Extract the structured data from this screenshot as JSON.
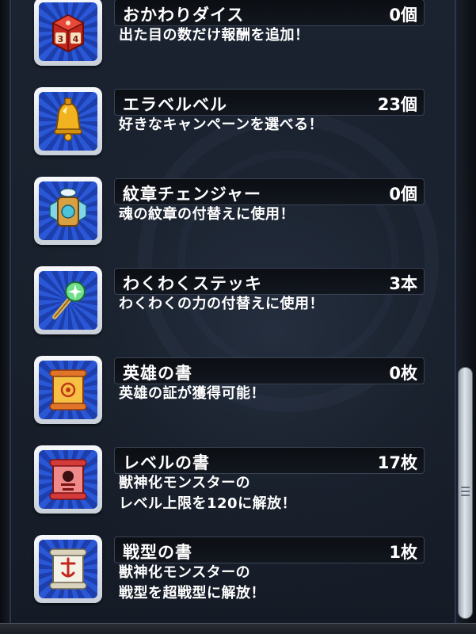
{
  "items": [
    {
      "name": "おかわりダイス",
      "count": "0個",
      "desc": [
        "出た目の数だけ報酬を追加！"
      ],
      "icon": "dice-icon",
      "accent": "#d23a2a"
    },
    {
      "name": "エラベルベル",
      "count": "23個",
      "desc": [
        "好きなキャンペーンを選べる！"
      ],
      "icon": "bell-icon",
      "accent": "#f0b020"
    },
    {
      "name": "紋章チェンジャー",
      "count": "0個",
      "desc": [
        "魂の紋章の付替えに使用！"
      ],
      "icon": "emblem-changer-icon",
      "accent": "#d8a040"
    },
    {
      "name": "わくわくステッキ",
      "count": "3本",
      "desc": [
        "わくわくの力の付替えに使用！"
      ],
      "icon": "wand-icon",
      "accent": "#48c070"
    },
    {
      "name": "英雄の書",
      "count": "0枚",
      "desc": [
        "英雄の証が獲得可能！"
      ],
      "icon": "hero-scroll-icon",
      "accent": "#e8a020"
    },
    {
      "name": "レベルの書",
      "count": "17枚",
      "desc": [
        "獣神化モンスターの",
        "レベル上限を120に解放！"
      ],
      "icon": "level-scroll-icon",
      "accent": "#e05050"
    },
    {
      "name": "戦型の書",
      "count": "1枚",
      "desc": [
        "獣神化モンスターの",
        "戦型を超戦型に解放！"
      ],
      "icon": "battle-type-scroll-icon",
      "accent": "#f2efe6"
    }
  ],
  "colors": {
    "panel": "#18202c",
    "icon_blue": "#2a57d6",
    "text": "#ffffff"
  }
}
